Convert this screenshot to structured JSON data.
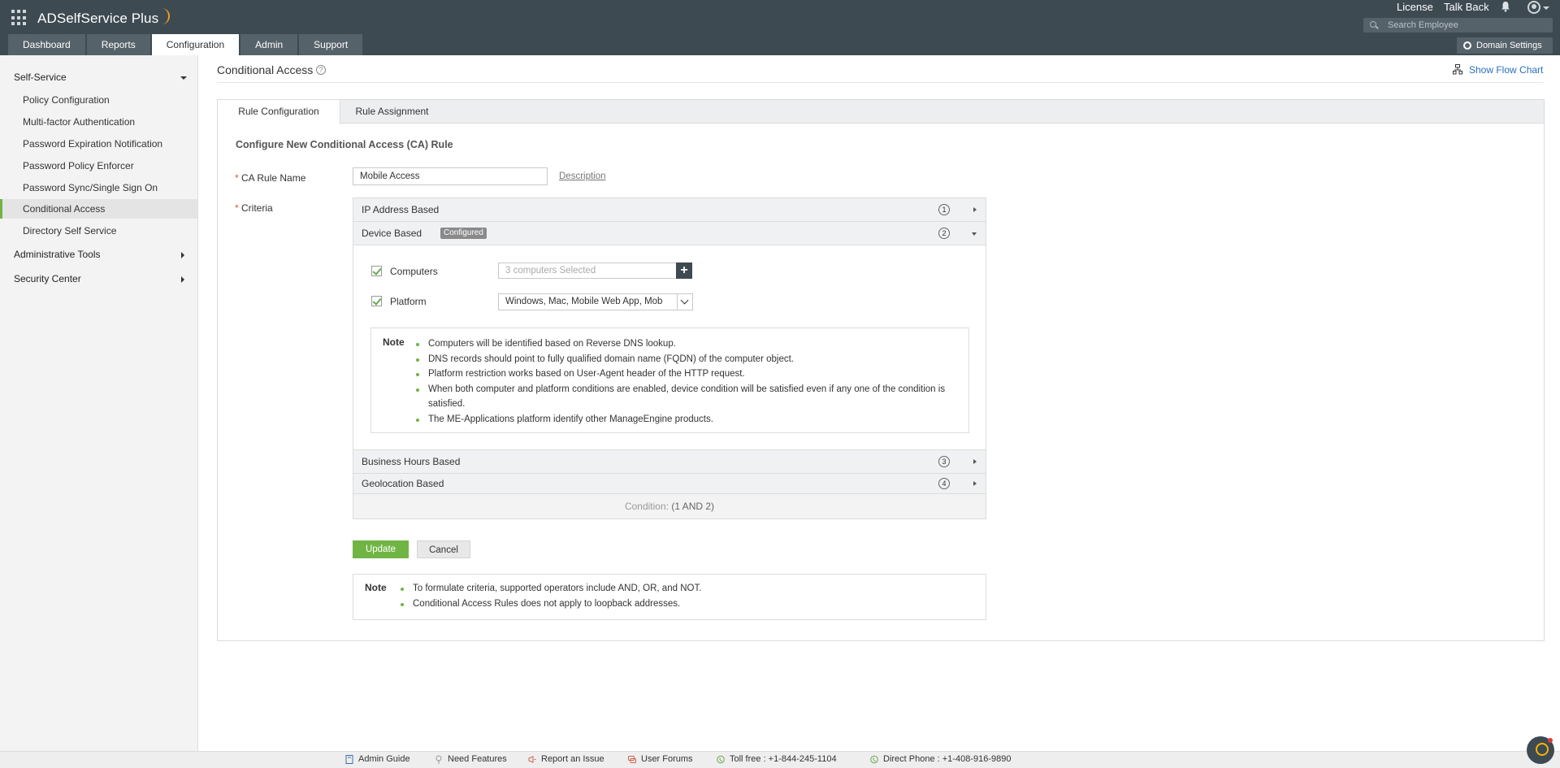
{
  "header": {
    "app_name": "ADSelfService Plus",
    "links": {
      "license": "License",
      "talk_back": "Talk Back"
    },
    "search": {
      "placeholder": "Search Employee"
    },
    "nav_tabs": [
      "Dashboard",
      "Reports",
      "Configuration",
      "Admin",
      "Support"
    ],
    "active_tab": "Configuration",
    "domain_settings": "Domain Settings"
  },
  "sidebar": {
    "groups": [
      {
        "label": "Self-Service",
        "expanded": true
      },
      {
        "label": "Administrative Tools",
        "expanded": false
      },
      {
        "label": "Security Center",
        "expanded": false
      }
    ],
    "items": [
      "Policy Configuration",
      "Multi-factor Authentication",
      "Password Expiration Notification",
      "Password Policy Enforcer",
      "Password Sync/Single Sign On",
      "Conditional Access",
      "Directory Self Service"
    ],
    "active_item": "Conditional Access"
  },
  "main": {
    "title": "Conditional Access",
    "help_icon": "?",
    "flow_chart_link": "Show Flow Chart",
    "tabs": [
      "Rule Configuration",
      "Rule Assignment"
    ],
    "active_tab": "Rule Configuration",
    "form": {
      "heading": "Configure New Conditional Access (CA) Rule",
      "required_mark": "*",
      "rule_name_label": "CA Rule Name",
      "rule_name_value": "Mobile Access",
      "description_link": "Description",
      "criteria_label": "Criteria",
      "criteria": [
        {
          "label": "IP Address Based",
          "number": "1"
        },
        {
          "label": "Device Based",
          "number": "2",
          "badge": "Configured"
        },
        {
          "label": "Business Hours Based",
          "number": "3"
        },
        {
          "label": "Geolocation Based",
          "number": "4"
        }
      ],
      "device": {
        "computers_label": "Computers",
        "computers_value": "3 computers Selected",
        "add_symbol": "+",
        "platform_label": "Platform",
        "platform_value": "Windows, Mac, Mobile Web App, Mob",
        "note_title": "Note",
        "notes": [
          "Computers will be identified based on Reverse DNS lookup.",
          "DNS records should point to fully qualified domain name (FQDN) of the computer object.",
          "Platform restriction works based on User-Agent header of the HTTP request.",
          "When both computer and platform conditions are enabled, device condition will be satisfied even if any one of the condition is satisfied.",
          "The ME-Applications platform identify other ManageEngine products."
        ]
      },
      "condition_label": "Condition:",
      "condition_value": "(1 AND 2)",
      "update_button": "Update",
      "cancel_button": "Cancel",
      "bottom_note_title": "Note",
      "bottom_notes": [
        "To formulate criteria, supported operators include AND, OR, and NOT.",
        "Conditional Access Rules does not apply to loopback addresses."
      ]
    }
  },
  "footer": {
    "items": [
      "Admin Guide",
      "Need Features",
      "Report an Issue",
      "User Forums",
      "Toll free : +1-844-245-1104",
      "Direct Phone : +1-408-916-9890"
    ]
  },
  "colors": {
    "header_bg": "#3e4a52",
    "accent_green": "#70b544",
    "link_blue": "#2a6ebd"
  }
}
